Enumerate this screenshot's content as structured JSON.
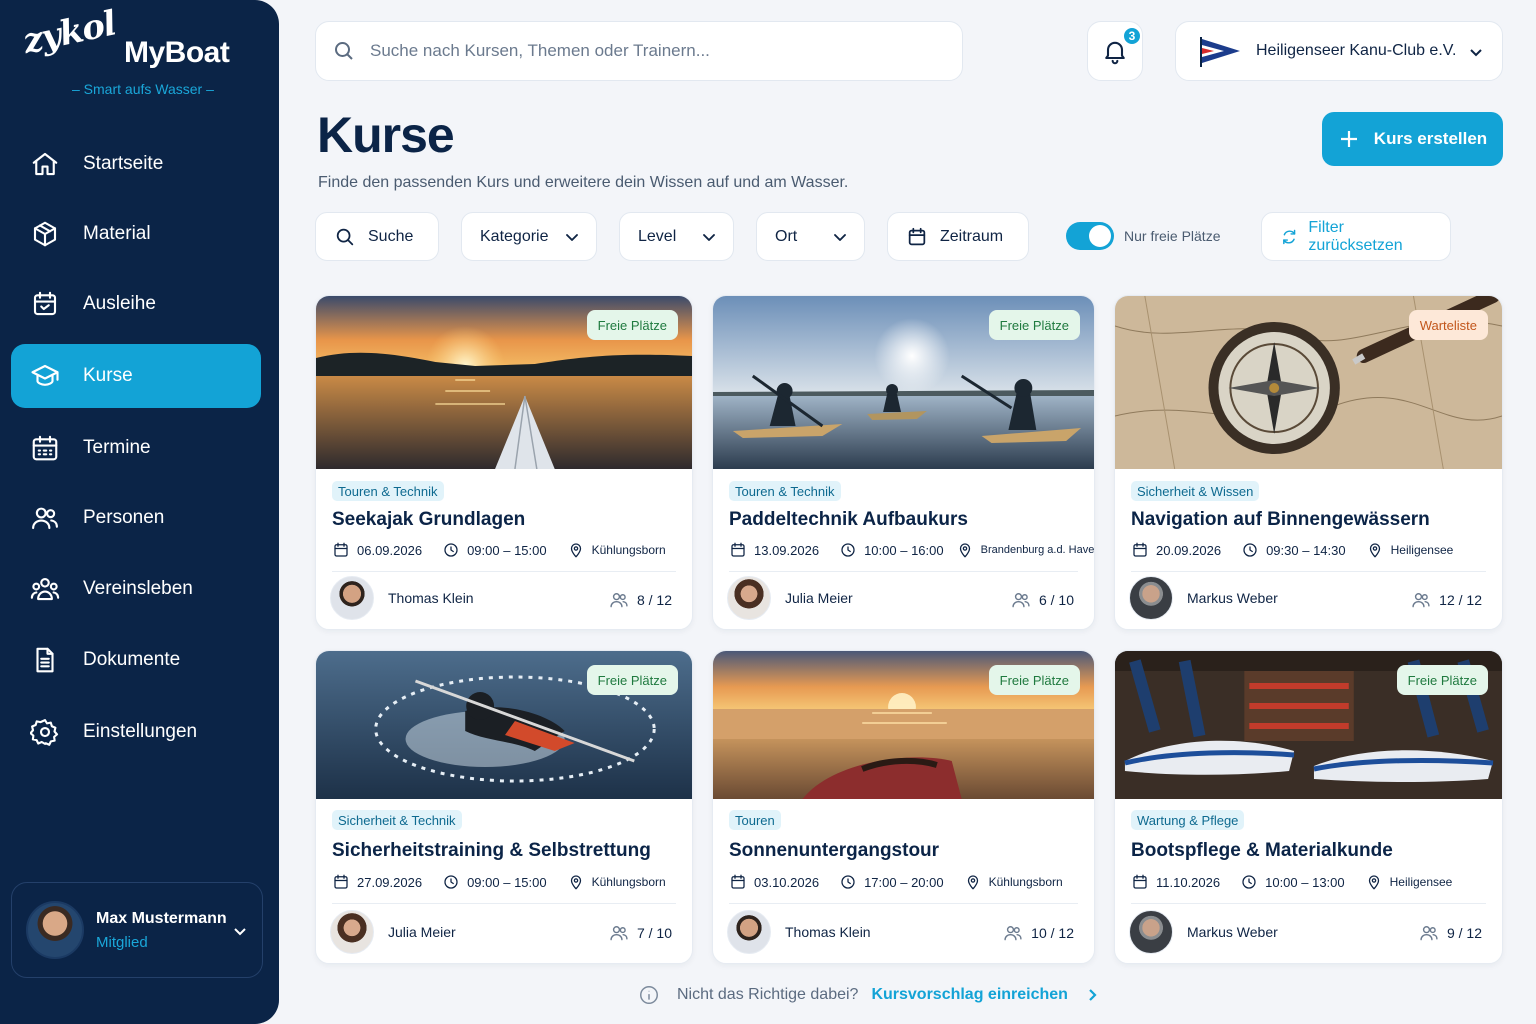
{
  "brand": {
    "script": "zykol",
    "name": "MyBoat",
    "tagline": "– Smart aufs Wasser –"
  },
  "sidebar": {
    "items": [
      {
        "label": "Startseite",
        "icon": "home-icon"
      },
      {
        "label": "Material",
        "icon": "box-icon"
      },
      {
        "label": "Ausleihe",
        "icon": "calendar-icon"
      },
      {
        "label": "Kurse",
        "icon": "graduation-cap-icon",
        "active": true
      },
      {
        "label": "Termine",
        "icon": "calendar-grid-icon"
      },
      {
        "label": "Personen",
        "icon": "users-icon"
      },
      {
        "label": "Vereinsleben",
        "icon": "group-icon"
      },
      {
        "label": "Dokumente",
        "icon": "document-icon"
      },
      {
        "label": "Einstellungen",
        "icon": "gear-icon"
      }
    ]
  },
  "user": {
    "name": "Max Mustermann",
    "role": "Mitglied"
  },
  "search": {
    "placeholder": "Suche nach Kursen, Themen oder Trainern..."
  },
  "notifications": {
    "count": "3"
  },
  "club": {
    "name": "Heiligenseer Kanu-Club e.V."
  },
  "header": {
    "title": "Kurse",
    "subtitle": "Finde den passenden Kurs und erweitere dein Wissen auf und am Wasser.",
    "create_label": "Kurs erstellen"
  },
  "filters": {
    "search": "Suche",
    "category": "Kategorie",
    "level": "Level",
    "location": "Ort",
    "period": "Zeitraum",
    "only_free": "Nur freie Plätze",
    "only_free_on": true,
    "reset": "Filter zurücksetzen"
  },
  "courses": [
    {
      "status": "Freie Plätze",
      "status_type": "free",
      "category": "Touren & Technik",
      "title": "Seekajak Grundlagen",
      "date": "06.09.2026",
      "time": "09:00 – 15:00",
      "location": "Kühlungsborn",
      "trainer": "Thomas Klein",
      "seats": "8 / 12",
      "image": "sunset-kayak-bow"
    },
    {
      "status": "Freie Plätze",
      "status_type": "free",
      "category": "Touren & Technik",
      "title": "Paddeltechnik Aufbaukurs",
      "date": "13.09.2026",
      "time": "10:00 – 16:00",
      "location": "Brandenburg a.d. Havel",
      "trainer": "Julia Meier",
      "seats": "6 / 10",
      "image": "kayakers-on-lake"
    },
    {
      "status": "Warteliste",
      "status_type": "wait",
      "category": "Sicherheit & Wissen",
      "title": "Navigation auf Binnengewässern",
      "date": "20.09.2026",
      "time": "09:30 – 14:30",
      "location": "Heiligensee",
      "trainer": "Markus Weber",
      "seats": "12 / 12",
      "image": "compass-on-map"
    },
    {
      "status": "Freie Plätze",
      "status_type": "free",
      "category": "Sicherheit & Technik",
      "title": "Sicherheitstraining & Selbstrettung",
      "date": "27.09.2026",
      "time": "09:00 – 15:00",
      "location": "Kühlungsborn",
      "trainer": "Julia Meier",
      "seats": "7 / 10",
      "image": "kayak-rescue-splash"
    },
    {
      "status": "Freie Plätze",
      "status_type": "free",
      "category": "Touren",
      "title": "Sonnenuntergangstour",
      "date": "03.10.2026",
      "time": "17:00 – 20:00",
      "location": "Kühlungsborn",
      "trainer": "Thomas Klein",
      "seats": "10 / 12",
      "image": "kayak-on-beach-sunset"
    },
    {
      "status": "Freie Plätze",
      "status_type": "free",
      "category": "Wartung & Pflege",
      "title": "Bootspflege & Materialkunde",
      "date": "11.10.2026",
      "time": "10:00 – 13:00",
      "location": "Heiligensee",
      "trainer": "Markus Weber",
      "seats": "9 / 12",
      "image": "kayak-storage-shed"
    }
  ],
  "footer": {
    "question": "Nicht das Richtige dabei?",
    "link": "Kursvorschlag einreichen"
  },
  "colors": {
    "sidebar": "#0b2447",
    "accent": "#13a3d6",
    "free": "#1f7a3f",
    "wait": "#c2561b"
  }
}
